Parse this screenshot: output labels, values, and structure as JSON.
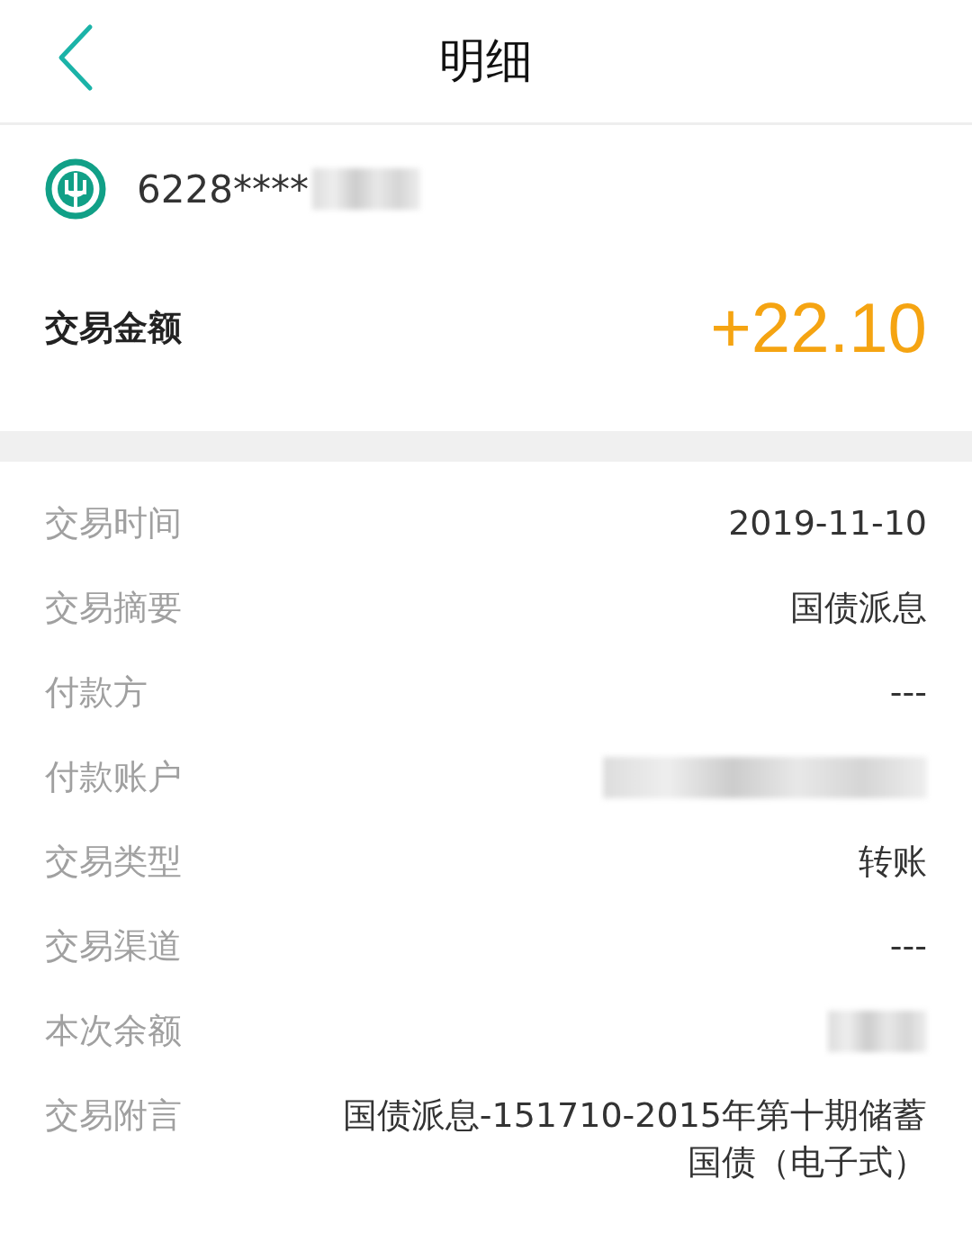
{
  "header": {
    "title": "明细"
  },
  "account": {
    "number": "6228****",
    "redacted": true
  },
  "amount": {
    "label": "交易金额",
    "value": "+22.10"
  },
  "rows": [
    {
      "label": "交易时间",
      "value": "2019-11-10",
      "redacted": false
    },
    {
      "label": "交易摘要",
      "value": "国债派息",
      "redacted": false
    },
    {
      "label": "付款方",
      "value": "---",
      "redacted": false
    },
    {
      "label": "付款账户",
      "redacted": true
    },
    {
      "label": "交易类型",
      "value": "转账",
      "redacted": false
    },
    {
      "label": "交易渠道",
      "value": "---",
      "redacted": false
    },
    {
      "label": "本次余额",
      "redacted": true
    },
    {
      "label": "交易附言",
      "value": "国债派息-151710-2015年第十期储蓄国债（电子式）",
      "redacted": false
    }
  ]
}
